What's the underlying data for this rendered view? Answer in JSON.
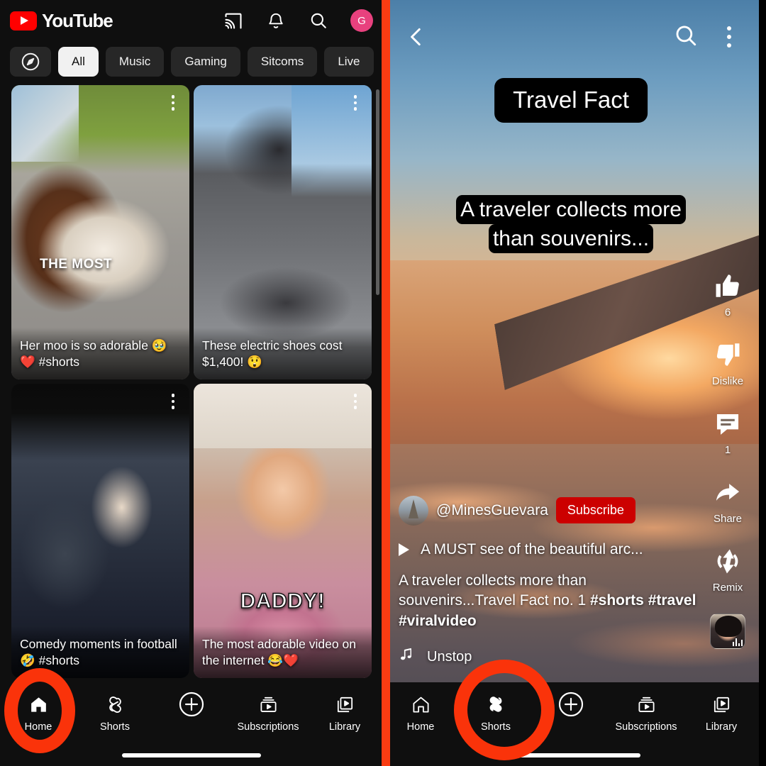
{
  "home": {
    "header": {
      "brand": "YouTube",
      "icons": [
        "cast-icon",
        "bell-icon",
        "search-icon"
      ],
      "avatar_initial": "G",
      "avatar_color": "#E8417E",
      "logo_color": "#FF0000"
    },
    "chips": [
      {
        "label": "",
        "icon": "compass-icon",
        "active": false
      },
      {
        "label": "All",
        "active": true
      },
      {
        "label": "Music",
        "active": false
      },
      {
        "label": "Gaming",
        "active": false
      },
      {
        "label": "Sitcoms",
        "active": false
      },
      {
        "label": "Live",
        "active": false
      }
    ],
    "videos": [
      {
        "title": "Her moo is so adorable 🥹❤️ #shorts",
        "overlay": "THE MOST"
      },
      {
        "title": "These electric shoes cost $1,400! 😲",
        "overlay": ""
      },
      {
        "title": "Comedy moments in football 🤣 #shorts",
        "overlay": ""
      },
      {
        "title": "The most adorable video on the internet 😂❤️",
        "overlay": "DADDY!"
      }
    ],
    "nav": [
      {
        "label": "Home",
        "icon": "home-icon",
        "active": true
      },
      {
        "label": "Shorts",
        "icon": "shorts-icon",
        "active": false
      },
      {
        "label": "",
        "icon": "plus-circle-icon",
        "active": false
      },
      {
        "label": "Subscriptions",
        "icon": "subscriptions-icon",
        "active": false
      },
      {
        "label": "Library",
        "icon": "library-icon",
        "active": false
      }
    ]
  },
  "shorts": {
    "topbar": {
      "back_icon": "back-chevron-icon",
      "search_icon": "search-icon",
      "more_icon": "kebab-menu-icon"
    },
    "captions": {
      "title": "Travel Fact",
      "body_line1": "A traveler collects more",
      "body_line2": "than souvenirs..."
    },
    "actions": [
      {
        "icon": "thumbs-up-icon",
        "label": "6"
      },
      {
        "icon": "thumbs-down-icon",
        "label": "Dislike"
      },
      {
        "icon": "comment-icon",
        "label": "1"
      },
      {
        "icon": "share-icon",
        "label": "Share"
      },
      {
        "icon": "remix-icon",
        "label": "Remix"
      }
    ],
    "channel": {
      "handle": "@MinesGuevara",
      "subscribe_label": "Subscribe",
      "subscribe_color": "#CC0000",
      "avatar_icon": "eiffel-tower-avatar"
    },
    "video_title": "A MUST see of the beautiful arc...",
    "description_plain": "A traveler collects more than souvenirs...Travel Fact no. 1 ",
    "description_tags": "#shorts #travel  #viralvideo",
    "music": {
      "icon": "music-note-icon",
      "label": "Unstop"
    },
    "nav": [
      {
        "label": "Home",
        "icon": "home-icon",
        "active": false
      },
      {
        "label": "Shorts",
        "icon": "shorts-icon",
        "active": true
      },
      {
        "label": "",
        "icon": "plus-circle-icon",
        "active": false
      },
      {
        "label": "Subscriptions",
        "icon": "subscriptions-icon",
        "active": false
      },
      {
        "label": "Library",
        "icon": "library-icon",
        "active": false
      }
    ]
  },
  "annotations": {
    "highlight_color": "#FA330A",
    "divider_color": "#FA3C12"
  }
}
